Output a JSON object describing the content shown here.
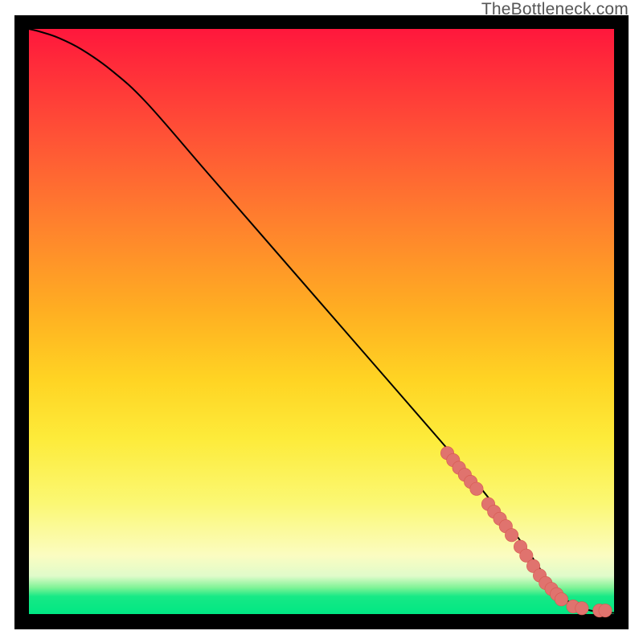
{
  "watermark": "TheBottleneck.com",
  "colors": {
    "frame": "#000000",
    "curve": "#000000",
    "marker_fill": "#e0736e",
    "marker_stroke": "#d6584f"
  },
  "chart_data": {
    "type": "line",
    "title": "",
    "xlabel": "",
    "ylabel": "",
    "xlim": [
      0,
      100
    ],
    "ylim": [
      0,
      100
    ],
    "curve": {
      "x": [
        0,
        2,
        5,
        9,
        14,
        20,
        30,
        40,
        50,
        60,
        70,
        76,
        80,
        84,
        86.5,
        88.5,
        90,
        92,
        94,
        96,
        98,
        100
      ],
      "y": [
        100,
        99.5,
        98.5,
        96.5,
        93,
        87.5,
        76,
        64.5,
        53,
        41.5,
        30,
        23,
        18,
        12.5,
        9,
        6,
        4,
        2.3,
        1.2,
        0.6,
        0.3,
        0.2
      ]
    },
    "markers": {
      "x": [
        71.5,
        72.5,
        73.5,
        74.5,
        75.5,
        76.5,
        78.5,
        79.5,
        80.5,
        81.5,
        82.5,
        84.0,
        85.0,
        86.2,
        87.3,
        88.3,
        89.3,
        90.2,
        91.0,
        93.0,
        94.5,
        97.5,
        98.5
      ],
      "y": [
        27.5,
        26.3,
        25.0,
        23.8,
        22.6,
        21.4,
        18.8,
        17.5,
        16.3,
        15.0,
        13.5,
        11.5,
        10.0,
        8.2,
        6.6,
        5.3,
        4.3,
        3.4,
        2.5,
        1.3,
        1.0,
        0.6,
        0.6
      ]
    }
  }
}
